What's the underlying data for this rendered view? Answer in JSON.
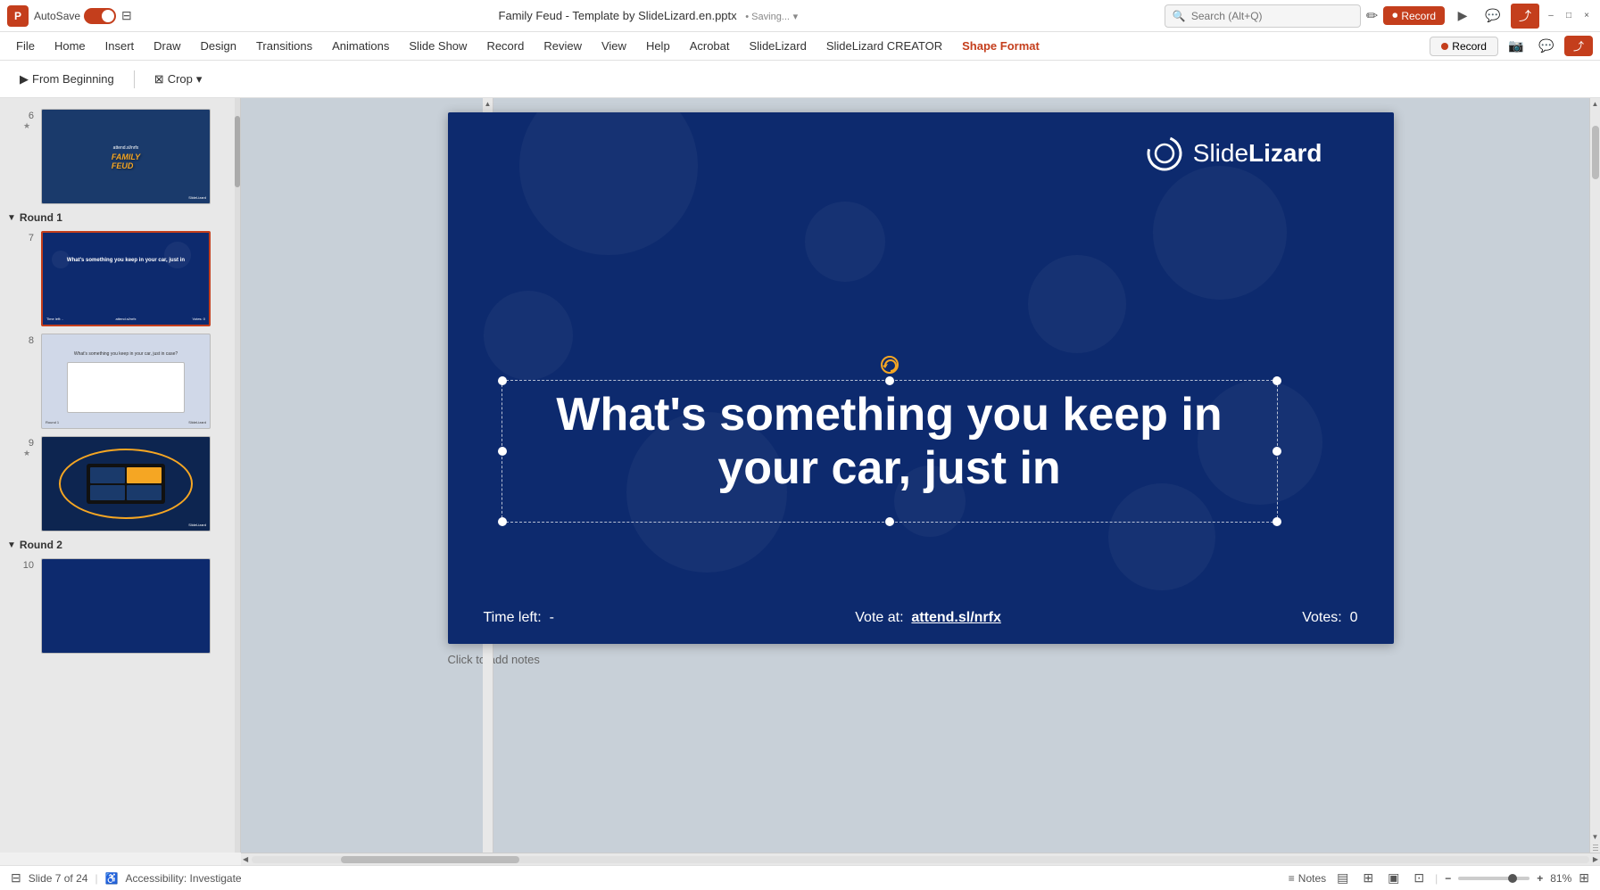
{
  "titlebar": {
    "autosave_label": "AutoSave",
    "file_name": "Family Feud - Template by SlideLizard.en.pptx",
    "saving_label": "• Saving...",
    "search_placeholder": "Search (Alt+Q)",
    "minimize_label": "–",
    "maximize_label": "□",
    "close_label": "×",
    "pencil_icon": "✏",
    "record_btn": "Record",
    "present_icon": "▶",
    "comment_icon": "💬",
    "share_icon": "⤴"
  },
  "menubar": {
    "items": [
      "File",
      "Home",
      "Insert",
      "Draw",
      "Design",
      "Transitions",
      "Animations",
      "Slide Show",
      "Record",
      "Review",
      "View",
      "Help",
      "Acrobat",
      "SlideLizard",
      "SlideLizard CREATOR"
    ],
    "active_item": "Shape Format",
    "record_btn": "Record",
    "icon1": "📷",
    "icon2": "💬",
    "icon3": "⤴"
  },
  "toolbar": {
    "from_beginning_label": "From Beginning",
    "crop_label": "Crop",
    "dropdown_icon": "▾"
  },
  "slides": {
    "section1": "Round 1",
    "section2": "Round 2",
    "items": [
      {
        "num": "6",
        "star": "★",
        "active": false,
        "bg": "dark"
      },
      {
        "num": "7",
        "star": "",
        "active": true,
        "bg": "dark"
      },
      {
        "num": "8",
        "star": "",
        "active": false,
        "bg": "gray"
      },
      {
        "num": "9",
        "star": "★",
        "active": false,
        "bg": "dark"
      },
      {
        "num": "10",
        "star": "",
        "active": false,
        "bg": "dark"
      }
    ]
  },
  "mainslide": {
    "logo_text_light": "Slide",
    "logo_text_bold": "Lizard",
    "main_question": "What's something you keep in your car, just in",
    "time_left_label": "Time left:",
    "time_left_value": "-",
    "vote_label": "Vote at:",
    "vote_url": "attend.sl/nrfx",
    "votes_label": "Votes:",
    "votes_value": "0"
  },
  "bottombar": {
    "slide_info": "Slide 7 of 24",
    "accessibility_label": "Accessibility: Investigate",
    "notes_label": "Notes",
    "zoom_value": "81%",
    "fit_icon": "⊞",
    "normal_view_icon": "▤",
    "slide_sorter_icon": "⊞",
    "reading_view_icon": "▣",
    "presenter_view_icon": "⊡",
    "zoom_out_icon": "−",
    "zoom_in_icon": "+"
  },
  "colors": {
    "accent": "#c43e1c",
    "slide_bg": "#0d2a6e",
    "dark_navy": "#0d2550",
    "white": "#ffffff",
    "gold": "#f5a623"
  }
}
